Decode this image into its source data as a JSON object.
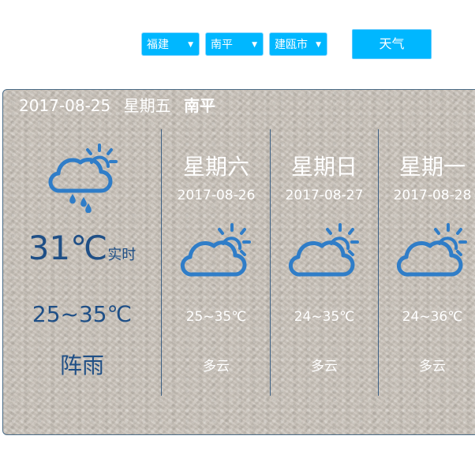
{
  "toolbar": {
    "province": "福建",
    "city": "南平",
    "district": "建瓯市",
    "weather_button": "天气",
    "caret": "▼"
  },
  "colors": {
    "accent": "#00b7ff",
    "panel_border": "#4a6b86",
    "today_text": "#1f4f86",
    "forecast_text": "#ffffff",
    "icon_blue": "#2f7dc8"
  },
  "today": {
    "date": "2017-08-25",
    "weekday": "星期五",
    "city": "南平",
    "icon": "cloud-sun-rain-icon",
    "current_temp": "31℃",
    "realtime_label": "实时",
    "range": "25~35℃",
    "condition": "阵雨"
  },
  "forecast": [
    {
      "weekday": "星期六",
      "date": "2017-08-26",
      "icon": "partly-cloudy-icon",
      "range": "25~35℃",
      "condition": "多云"
    },
    {
      "weekday": "星期日",
      "date": "2017-08-27",
      "icon": "partly-cloudy-icon",
      "range": "24~35℃",
      "condition": "多云"
    },
    {
      "weekday": "星期一",
      "date": "2017-08-28",
      "icon": "partly-cloudy-icon",
      "range": "24~36℃",
      "condition": "多云"
    }
  ]
}
